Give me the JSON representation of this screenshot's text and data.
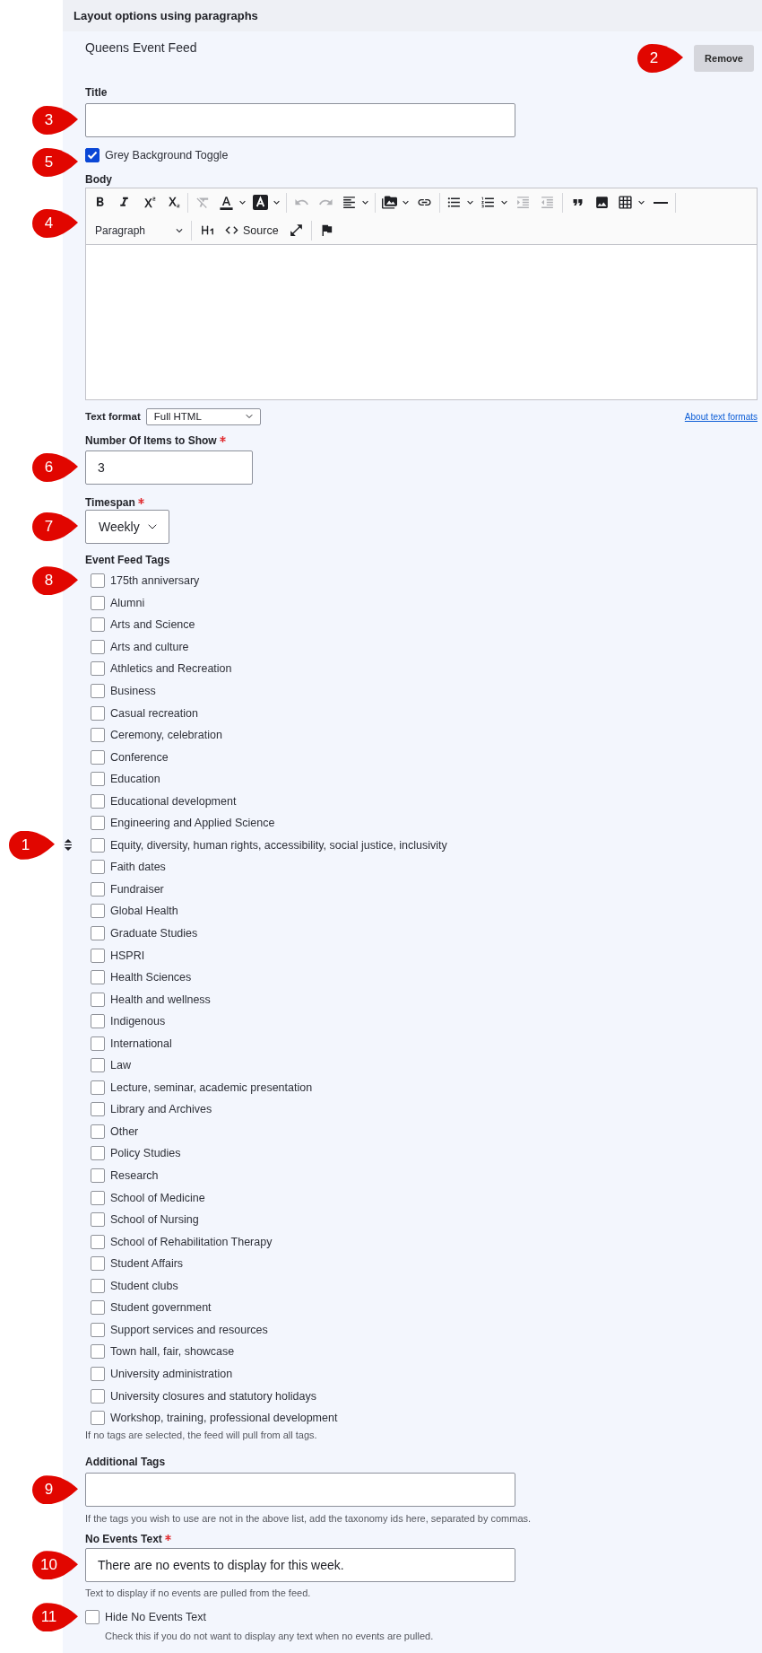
{
  "section": {
    "title": "Layout options using paragraphs"
  },
  "paragraph": {
    "type_name": "Queens Event Feed",
    "remove_button": {
      "label": "Remove",
      "callout": "2"
    }
  },
  "title_field": {
    "label": "Title",
    "required": false,
    "callout": "3"
  },
  "grey_background": {
    "label": "Grey Background Toggle",
    "checked": true,
    "callout": "5"
  },
  "body": {
    "label": "Body",
    "required": false,
    "callout": "4",
    "block_format": "Paragraph",
    "tools": [
      {
        "disabled": false
      },
      {
        "disabled": false
      },
      {
        "disabled": false
      },
      {
        "disabled": false
      },
      {
        "disabled": true
      },
      {
        "disabled": false
      },
      {
        "disabled": false
      },
      {
        "disabled": true
      },
      {
        "disabled": true
      },
      {
        "disabled": false
      },
      {
        "disabled": false
      },
      {
        "disabled": false
      },
      {
        "disabled": false
      },
      {
        "disabled": false
      },
      {
        "disabled": true
      },
      {
        "disabled": true
      },
      {
        "disabled": false
      },
      {
        "disabled": false
      },
      {
        "disabled": false
      },
      {
        "disabled": false
      },
      {
        "disabled": false
      },
      {
        "disabled": false,
        "label": "Source"
      },
      {
        "disabled": false
      },
      {
        "disabled": false
      }
    ],
    "text_format": {
      "label": "Text format",
      "value": "Full HTML",
      "help_link": "About text formats"
    }
  },
  "items_to_show": {
    "label": "Number Of Items to Show",
    "required": true,
    "value": "3",
    "callout": "6"
  },
  "timespan": {
    "label": "Timespan",
    "required": true,
    "value": "Weekly",
    "callout": "7"
  },
  "event_feed_tags": {
    "label": "Event Feed Tags",
    "required": false,
    "tags": [
      {
        "label": "175th anniversary",
        "checked": false,
        "drag_handle": false,
        "callout": "8"
      },
      {
        "label": "Alumni",
        "checked": false,
        "drag_handle": false
      },
      {
        "label": "Arts and Science",
        "checked": false,
        "drag_handle": false
      },
      {
        "label": "Arts and culture",
        "checked": false,
        "drag_handle": false
      },
      {
        "label": "Athletics and Recreation",
        "checked": false,
        "drag_handle": false
      },
      {
        "label": "Business",
        "checked": false,
        "drag_handle": false
      },
      {
        "label": "Casual recreation",
        "checked": false,
        "drag_handle": false
      },
      {
        "label": "Ceremony, celebration",
        "checked": false,
        "drag_handle": false
      },
      {
        "label": "Conference",
        "checked": false,
        "drag_handle": false
      },
      {
        "label": "Education",
        "checked": false,
        "drag_handle": false
      },
      {
        "label": "Educational development",
        "checked": false,
        "drag_handle": false
      },
      {
        "label": "Engineering and Applied Science",
        "checked": false,
        "drag_handle": false
      },
      {
        "label": "Equity, diversity, human rights, accessibility, social justice, inclusivity",
        "checked": false,
        "drag_handle": true,
        "callout": "1"
      },
      {
        "label": "Faith dates",
        "checked": false,
        "drag_handle": false
      },
      {
        "label": "Fundraiser",
        "checked": false,
        "drag_handle": false
      },
      {
        "label": "Global Health",
        "checked": false,
        "drag_handle": false
      },
      {
        "label": "Graduate Studies",
        "checked": false,
        "drag_handle": false
      },
      {
        "label": "HSPRI",
        "checked": false,
        "drag_handle": false
      },
      {
        "label": "Health Sciences",
        "checked": false,
        "drag_handle": false
      },
      {
        "label": "Health and wellness",
        "checked": false,
        "drag_handle": false
      },
      {
        "label": "Indigenous",
        "checked": false,
        "drag_handle": false
      },
      {
        "label": "International",
        "checked": false,
        "drag_handle": false
      },
      {
        "label": "Law",
        "checked": false,
        "drag_handle": false
      },
      {
        "label": "Lecture, seminar, academic presentation",
        "checked": false,
        "drag_handle": false
      },
      {
        "label": "Library and Archives",
        "checked": false,
        "drag_handle": false
      },
      {
        "label": "Other",
        "checked": false,
        "drag_handle": false
      },
      {
        "label": "Policy Studies",
        "checked": false,
        "drag_handle": false
      },
      {
        "label": "Research",
        "checked": false,
        "drag_handle": false
      },
      {
        "label": "School of Medicine",
        "checked": false,
        "drag_handle": false
      },
      {
        "label": "School of Nursing",
        "checked": false,
        "drag_handle": false
      },
      {
        "label": "School of Rehabilitation Therapy",
        "checked": false,
        "drag_handle": false
      },
      {
        "label": "Student Affairs",
        "checked": false,
        "drag_handle": false
      },
      {
        "label": "Student clubs",
        "checked": false,
        "drag_handle": false
      },
      {
        "label": "Student government",
        "checked": false,
        "drag_handle": false
      },
      {
        "label": "Support services and resources",
        "checked": false,
        "drag_handle": false
      },
      {
        "label": "Town hall, fair, showcase",
        "checked": false,
        "drag_handle": false
      },
      {
        "label": "University administration",
        "checked": false,
        "drag_handle": false
      },
      {
        "label": "University closures and statutory holidays",
        "checked": false,
        "drag_handle": false
      },
      {
        "label": "Workshop, training, professional development",
        "checked": false,
        "drag_handle": false
      }
    ],
    "help": "If no tags are selected, the feed will pull from all tags."
  },
  "additional_tags": {
    "label": "Additional Tags",
    "required": false,
    "callout": "9",
    "help": "If the tags you wish to use are not in the above list, add the taxonomy ids here, separated by commas."
  },
  "no_events_text": {
    "label": "No Events Text",
    "required": true,
    "value": "There are no events to display for this week.",
    "callout": "10",
    "help": "Text to display if no events are pulled from the feed."
  },
  "hide_no_events": {
    "label": "Hide No Events Text",
    "checked": false,
    "callout": "11",
    "help": "Check this if you do not want to display any text when no events are pulled."
  }
}
